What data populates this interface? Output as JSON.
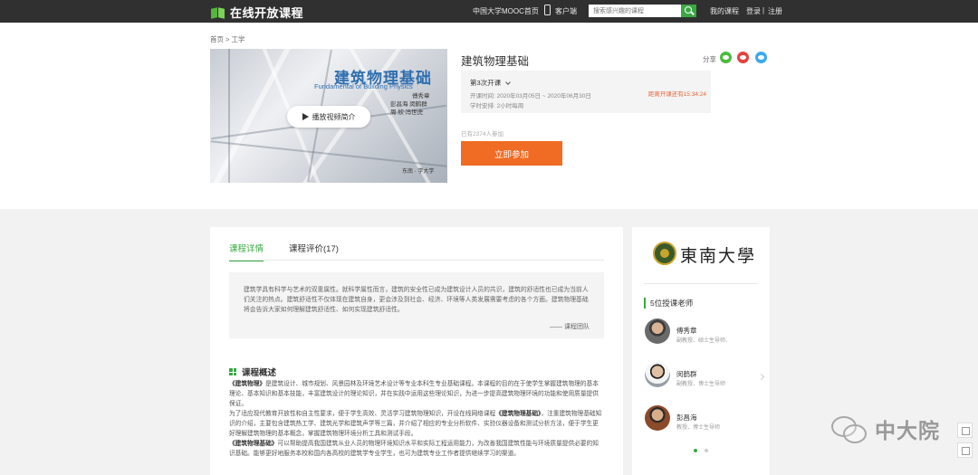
{
  "topbar": {
    "logo_text": "在线开放课程",
    "nav_home": "中国大学MOOC首页",
    "nav_client": "客户端",
    "search_placeholder": "搜索感兴趣的课程",
    "my_courses": "我的课程",
    "login": "登录",
    "separator": "|",
    "register": "注册"
  },
  "breadcrumb": "首页 > 工学",
  "cover": {
    "title": "建筑物理基础",
    "subtitle": "Fundamental of Building Physics",
    "authors": [
      "傅秀章",
      "彭昌海  闵鹤群",
      "周  欣  冯世虎"
    ],
    "footer": "东南 · 学大学",
    "play_label": "播放视频简介"
  },
  "course": {
    "title": "建筑物理基础",
    "share_label": "分享",
    "session": "第3次开课",
    "open_time": "开课时间:   2020年03月05日 ~ 2020年06月30日",
    "workload": "学时安排:   2小时每周",
    "countdown": "距离开课还有15:34:24",
    "participants": "已有2374人参加",
    "join_label": "立即参加"
  },
  "tabs": {
    "details": "课程详情",
    "reviews": "课程评价(17)"
  },
  "intro": {
    "text": "建筑学具有科学与艺术的双重属性。就科学属性而言，建筑的安全性已成为建筑设计人员的共识，建筑的舒适性也已成为当前人们关注的热点。建筑舒适性不仅体现在建筑自身，更会涉及到社会、经济、环境等人类发展需要考虑的各个方面。建筑物理基础将会告诉大家如何理解建筑舒适性、如何实现建筑舒适性。",
    "signature": "—— 课程团队"
  },
  "overview": {
    "title": "课程概述",
    "p1_bold": "《建筑物理》",
    "p1": "是建筑设计、城市规划、风景园林及环境艺术设计等专业本科生专业基础课程。本课程的目的在于使学生掌握建筑物理的基本理论、基本知识和基本技能，丰富建筑设计的理论知识，并在实践中运用这些理论知识，为进一步提高建筑物理环境的功能和使用质量提供保证。",
    "p2a": "为了适应现代教育开放性和自主性要求，便于学生高效、灵活学习建筑物理知识，开设在线网络课程",
    "p2_bold": "《建筑物理基础》",
    "p2b": "，注重建筑物理基础知识的介绍，主要包含建筑热工学、建筑光学和建筑声学等三篇，并介绍了相应的专业分析软件、实验仪器设备和测试分析方法，便于学生更好理解建筑物理的基本概念，掌握建筑物理环境分析工具和测试手段。",
    "p3_bold": "《建筑物理基础》",
    "p3": "可以帮助提高我国建筑从业人员的物理环境知识水平和实际工程运用能力，为改善我国建筑性能与环境质量提供必要的知识基础。能够更好地服务本校和国内各高校的建筑学专业学生，也可为建筑专业工作者提供继续学习的渠道。"
  },
  "sidebar": {
    "school": "東南大學",
    "teacher_heading": "5位授课老师",
    "teachers": [
      {
        "name": "傅秀章",
        "title": "副教授、硕士生导师、"
      },
      {
        "name": "闵鹤群",
        "title": "副教授、博士生导师"
      },
      {
        "name": "彭昌海",
        "title": "教授、博士生导师"
      }
    ]
  },
  "watermark": "中大院",
  "colors": {
    "accent_green": "#39a842",
    "join_orange": "#f06b24",
    "topbar": "#303030",
    "cover_title_blue": "#2f6fb0"
  }
}
